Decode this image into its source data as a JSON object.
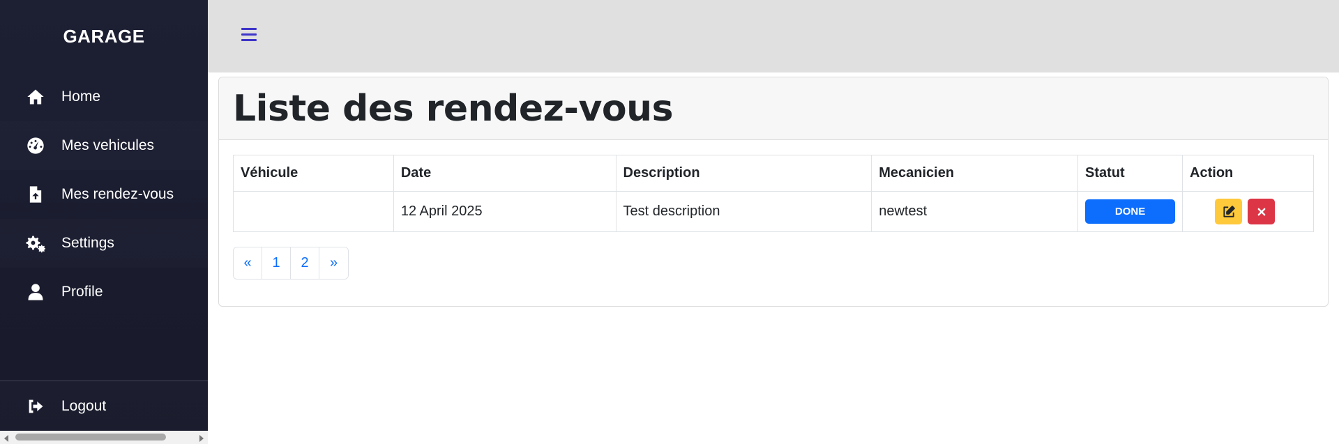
{
  "sidebar": {
    "brand": "GARAGE",
    "items": [
      {
        "label": "Home",
        "icon": "home-icon"
      },
      {
        "label": "Mes vehicules",
        "icon": "tachometer-icon"
      },
      {
        "label": "Mes rendez-vous",
        "icon": "file-upload-icon"
      },
      {
        "label": "Settings",
        "icon": "gears-icon"
      },
      {
        "label": "Profile",
        "icon": "user-icon"
      }
    ],
    "logout": {
      "label": "Logout",
      "icon": "sign-out-icon"
    }
  },
  "topbar": {
    "menu_icon": "hamburger-icon"
  },
  "page": {
    "title": "Liste des rendez-vous",
    "table": {
      "headers": [
        "Véhicule",
        "Date",
        "Description",
        "Mecanicien",
        "Statut",
        "Action"
      ],
      "rows": [
        {
          "vehicule": "",
          "date": "12 April 2025",
          "description": "Test description",
          "mecanicien": "newtest",
          "statut": "DONE"
        }
      ]
    },
    "pagination": [
      "«",
      "1",
      "2",
      "»"
    ]
  },
  "colors": {
    "sidebar_bg": "#1d1f33",
    "topbar_bg": "#e0e0e0",
    "accent": "#3d34c9",
    "status_done": "#0d6efd",
    "edit_button": "#ffc93c",
    "delete_button": "#dc3545",
    "link": "#0d6efd"
  }
}
